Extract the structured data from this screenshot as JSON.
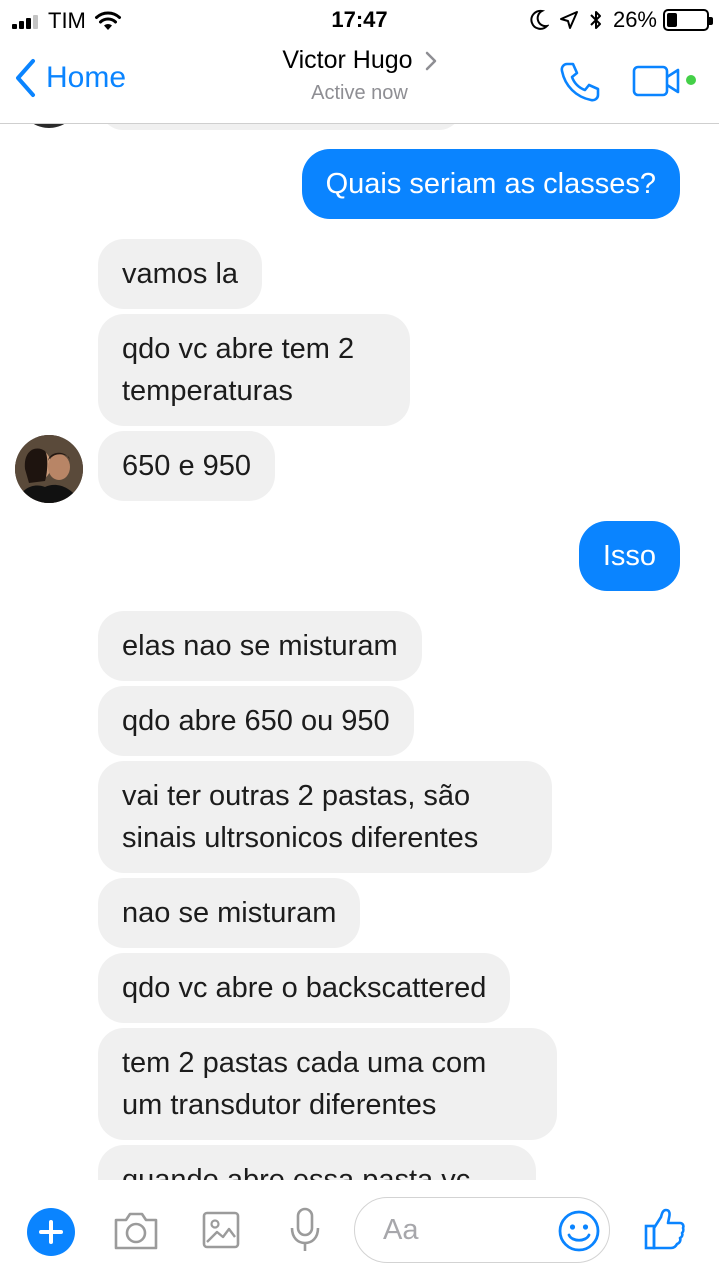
{
  "status_bar": {
    "carrier": "TIM",
    "time": "17:47",
    "battery_percent": "26%",
    "battery_level": 0.26
  },
  "nav": {
    "back_label": "Home",
    "contact_name": "Victor Hugo",
    "presence": "Active now",
    "accent_color": "#0a84ff",
    "active_indicator_color": "#44d048"
  },
  "messages": [
    {
      "direction": "out",
      "text": "Quais seriam as classes?"
    },
    {
      "direction": "in",
      "text": "vamos la"
    },
    {
      "direction": "in",
      "text": "qdo vc abre tem 2 temperaturas"
    },
    {
      "direction": "in",
      "text": "650 e 950"
    },
    {
      "direction": "out",
      "text": "Isso"
    },
    {
      "direction": "in",
      "text": "elas nao se misturam"
    },
    {
      "direction": "in",
      "text": "qdo abre 650 ou 950"
    },
    {
      "direction": "in",
      "text": "vai ter outras 2 pastas, são sinais ultrsonicos diferentes"
    },
    {
      "direction": "in",
      "text": "nao se misturam"
    },
    {
      "direction": "in",
      "text": "qdo vc abre o backscattered"
    },
    {
      "direction": "in",
      "text": "tem 2 pastas cada uma com um transdutor diferentes"
    },
    {
      "direction": "in",
      "text": "quando abre essa pasta vc"
    }
  ],
  "composer": {
    "placeholder": "Aa",
    "icons": [
      "plus-icon",
      "camera-icon",
      "gallery-icon",
      "microphone-icon",
      "emoji-icon",
      "thumbs-up-icon"
    ]
  }
}
